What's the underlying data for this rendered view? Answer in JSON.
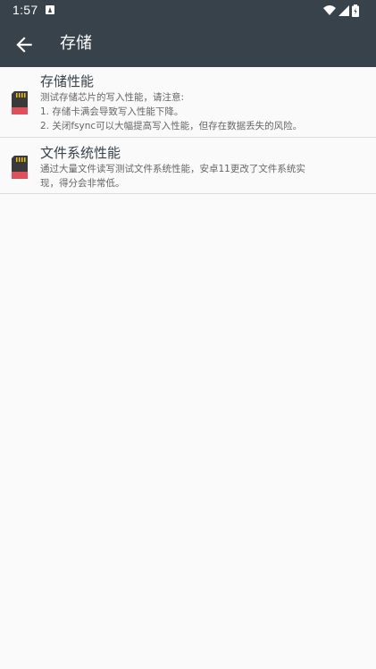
{
  "status_bar": {
    "time": "1:57",
    "icons": [
      "notification-a-icon",
      "wifi-icon",
      "signal-icon",
      "battery-icon"
    ]
  },
  "toolbar": {
    "title": "存储",
    "back_icon": "arrow-back-icon"
  },
  "items": [
    {
      "title": "存储性能",
      "desc": [
        "测试存储芯片的写入性能，请注意:",
        "1. 存储卡满会导致写入性能下降。",
        "2. 关闭fsync可以大幅提高写入性能，但存在数据丢失的风险。"
      ],
      "icon": "sd-card-icon"
    },
    {
      "title": "文件系统性能",
      "desc": [
        "通过大量文件读写测试文件系统性能，安卓11更改了文件系统实",
        "现，得分会非常低。"
      ],
      "icon": "sd-card-icon"
    }
  ],
  "colors": {
    "toolbar_bg": "#37424a",
    "page_bg": "#fafafa",
    "title_text": "#37424a",
    "desc_text": "#666666"
  }
}
